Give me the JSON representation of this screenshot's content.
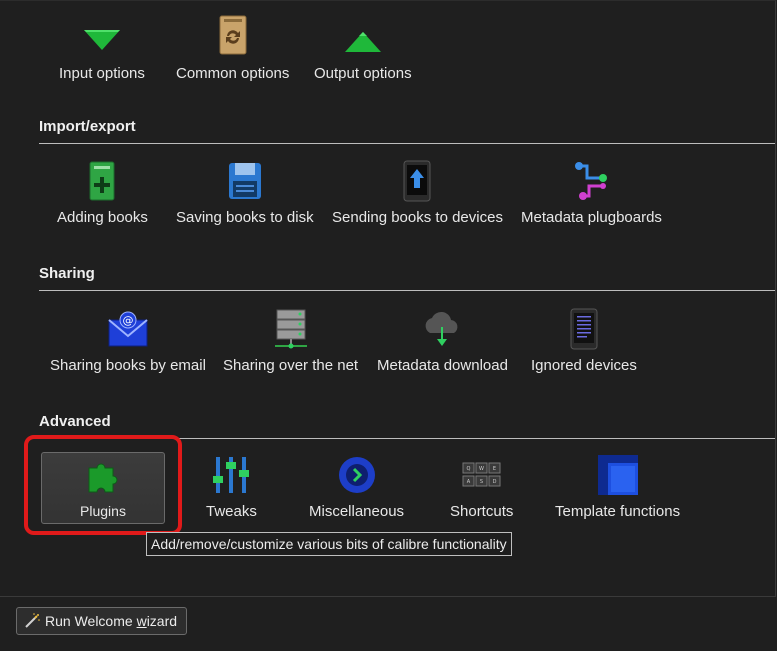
{
  "top_row": [
    {
      "label": "Input options",
      "icon": "green-down-triangle-icon"
    },
    {
      "label": "Common options",
      "icon": "book-refresh-icon"
    },
    {
      "label": "Output options",
      "icon": "green-up-triangle-icon"
    }
  ],
  "sections": {
    "import_export": {
      "title": "Import/export",
      "items": [
        {
          "label": "Adding books",
          "icon": "add-book-icon"
        },
        {
          "label": "Saving books to disk",
          "icon": "floppy-disk-icon"
        },
        {
          "label": "Sending books to devices",
          "icon": "device-upload-icon"
        },
        {
          "label": "Metadata plugboards",
          "icon": "plugboard-icon"
        }
      ]
    },
    "sharing": {
      "title": "Sharing",
      "items": [
        {
          "label": "Sharing books by email",
          "icon": "email-envelope-icon"
        },
        {
          "label": "Sharing over the net",
          "icon": "server-icon"
        },
        {
          "label": "Metadata download",
          "icon": "cloud-download-icon"
        },
        {
          "label": "Ignored devices",
          "icon": "ereader-icon"
        }
      ]
    },
    "advanced": {
      "title": "Advanced",
      "items": [
        {
          "label": "Plugins",
          "icon": "puzzle-piece-icon"
        },
        {
          "label": "Tweaks",
          "icon": "sliders-icon"
        },
        {
          "label": "Miscellaneous",
          "icon": "blue-chevron-circle-icon"
        },
        {
          "label": "Shortcuts",
          "icon": "keyboard-keys-icon"
        },
        {
          "label": "Template functions",
          "icon": "template-layout-icon"
        }
      ]
    }
  },
  "tooltip": "Add/remove/customize various bits of calibre functionality",
  "wizard_button": {
    "prefix": "Run Welcome ",
    "underlined": "w",
    "suffix": "izard"
  },
  "colors": {
    "highlight": "#e01a1a",
    "green": "#1fb83a",
    "blue": "#1d4fe0"
  }
}
